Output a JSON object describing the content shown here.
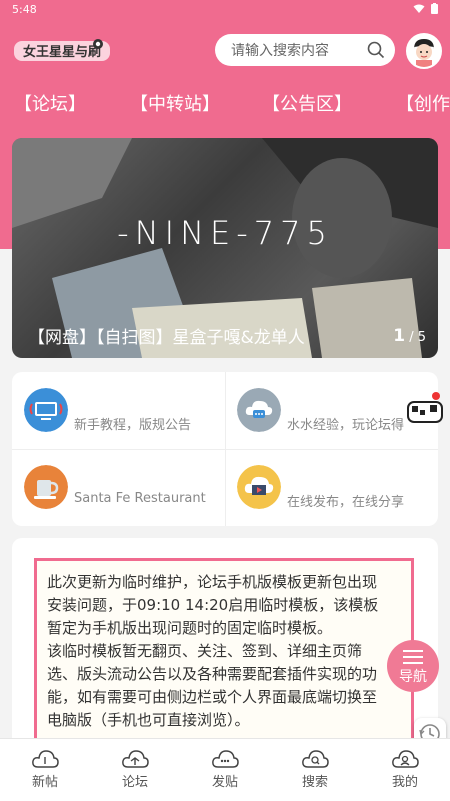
{
  "status": {
    "time": "5:48"
  },
  "header": {
    "logo_text": "女王星星与刷",
    "search_placeholder": "请输入搜索内容"
  },
  "nav": {
    "tabs": [
      "【论坛】",
      "【中转站】",
      "【公告区】",
      "【创作"
    ]
  },
  "banner": {
    "overlay_text": "-NINE-775",
    "caption": "【网盘】【自扫图】星盒子嘎&龙单人",
    "page_current": "1",
    "page_total": "/ 5"
  },
  "quick_links": [
    {
      "text": "新手教程，版规公告",
      "icon": "monitor-icon",
      "color": "#3b8fd8"
    },
    {
      "text": "水水经验，玩论坛得",
      "icon": "chat-cloud-icon",
      "color": "#9aa9b5"
    },
    {
      "text": "Santa Fe Restaurant",
      "icon": "cup-icon",
      "color": "#e8833a"
    },
    {
      "text": "在线发布，在线分享",
      "icon": "video-cloud-icon",
      "color": "#f4c34a"
    }
  ],
  "notice": {
    "lines": [
      "此次更新为临时维护，论坛手机版模板更新包出现",
      "安装问题，于09:10  14:20启用临时模板，该模板",
      "暂定为手机版出现问题时的固定临时模板。",
      "该临时模板暂无翻页、关注、签到、详细主页筛",
      "选、版头流动公告以及各种需要配套插件实现的功",
      "能，如有需要可由侧边栏或个人界面最底端切换至",
      "电脑版（手机也可直接浏览）。"
    ]
  },
  "fab": {
    "label": "导航"
  },
  "bottom_nav": [
    {
      "label": "新帖",
      "icon": "cloud-icon"
    },
    {
      "label": "论坛",
      "icon": "cloud-icon"
    },
    {
      "label": "发贴",
      "icon": "cloud-upload-icon"
    },
    {
      "label": "搜索",
      "icon": "cloud-search-icon"
    },
    {
      "label": "我的",
      "icon": "cloud-user-icon"
    }
  ],
  "colors": {
    "brand": "#f06b8f"
  }
}
